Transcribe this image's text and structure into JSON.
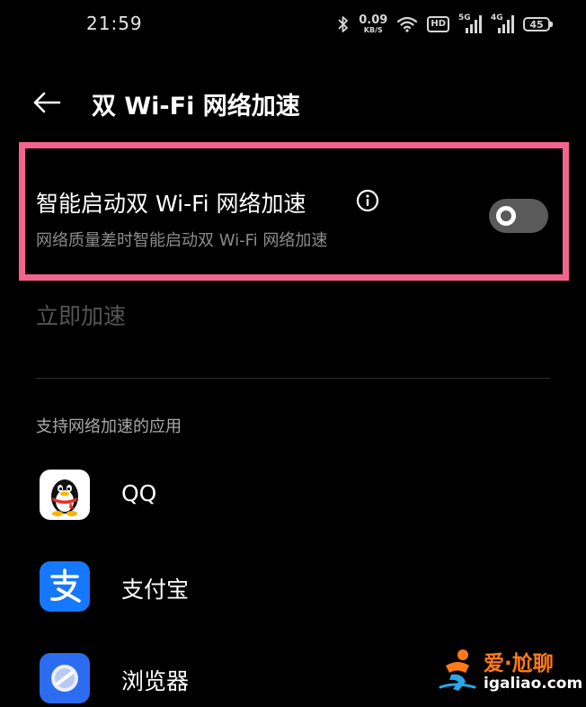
{
  "status_bar": {
    "time": "21:59",
    "net_speed_value": "0.09",
    "net_speed_unit": "KB/S",
    "hd_label": "HD",
    "signal_1_gen": "5G",
    "signal_2_gen": "4G",
    "battery_level": "45",
    "icons": [
      "bluetooth-icon",
      "wifi-icon",
      "signal-icon",
      "battery-icon"
    ]
  },
  "header": {
    "back_icon": "arrow-left-icon",
    "title": "双 Wi-Fi 网络加速"
  },
  "smart_toggle": {
    "title": "智能启动双 Wi-Fi 网络加速",
    "subtitle": "网络质量差时智能启动双 Wi-Fi 网络加速",
    "info_icon": "info-circle-icon",
    "enabled": false,
    "highlight_color": "#f2648e"
  },
  "accelerate_now": {
    "label": "立即加速",
    "enabled": false
  },
  "apps_section": {
    "header": "支持网络加速的应用",
    "items": [
      {
        "name": "QQ",
        "icon": "qq-penguin-icon"
      },
      {
        "name": "支付宝",
        "icon": "alipay-icon"
      },
      {
        "name": "浏览器",
        "icon": "browser-icon"
      }
    ]
  },
  "watermark": {
    "text_top": "爱·尬聊",
    "text_bottom": "igaliao.com"
  },
  "colors": {
    "background": "#000000",
    "toggle_off": "#5a5a5a",
    "disabled_text": "#555555",
    "secondary_text": "#8c8c8c"
  }
}
